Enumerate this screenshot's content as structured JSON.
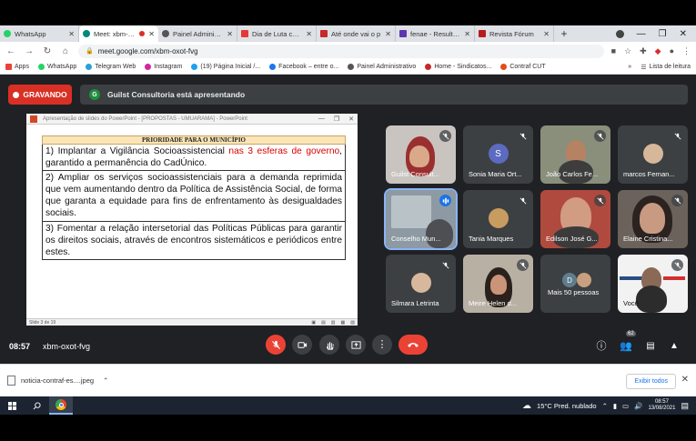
{
  "browser": {
    "tabs": [
      {
        "label": "WhatsApp",
        "color": "#25d366"
      },
      {
        "label": "Meet: xbm-oxot-fvg",
        "color": "#00897b",
        "active": true
      },
      {
        "label": "Painel Administrativo",
        "color": "#555555"
      },
      {
        "label": "Dia de Luta contra",
        "color": "#e53935"
      },
      {
        "label": "Até onde vai o p",
        "color": "#c62828"
      },
      {
        "label": "fenae - Resultados",
        "color": "#5e35b1"
      },
      {
        "label": "Revista Fórum",
        "color": "#b71c1c"
      }
    ],
    "url": "meet.google.com/xbm-oxot-fvg",
    "bookmarks": [
      {
        "label": "Apps",
        "color": "#ea4335"
      },
      {
        "label": "WhatsApp",
        "color": "#25d366"
      },
      {
        "label": "Telegram Web",
        "color": "#2aa0da"
      },
      {
        "label": "Instagram",
        "color": "#d6249f"
      },
      {
        "label": "(19) Página Inicial /...",
        "color": "#1da1f2"
      },
      {
        "label": "Facebook – entre o...",
        "color": "#1877f2"
      },
      {
        "label": "Painel Administrativo",
        "color": "#555555"
      },
      {
        "label": "Home - Sindicatos...",
        "color": "#c62828"
      },
      {
        "label": "Contraf CUT",
        "color": "#e64a19"
      }
    ],
    "reading_list": "Lista de leitura"
  },
  "meet": {
    "recording_label": "GRAVANDO",
    "presenting_avatar": "G",
    "presenting_text": "Guilst Consultoria está apresentando",
    "slide": {
      "window_title": "Apresentação de slides do PowerPoint - [PROPOSTAS - UMUARAMA] - PowerPoint",
      "heading": "PRIORIDADE PARA O MUNICÍPIO",
      "item1_pre": "1) Implantar a  Vigilância Socioassistencial ",
      "item1_red": "nas 3 esferas de governo",
      "item1_post": ", garantido a permanência do CadÚnico.",
      "item2": "2) Ampliar os serviços socioassistenciais para a demanda reprimida que vem aumentando dentro da Política de Assistência Social, de forma que garanta a equidade para fins de enfrentamento às desigualdades sociais.",
      "item3": "3) Fomentar a relação intersetorial das Políticas Públicas para garantir os direitos sociais, através de encontros sistemáticos e periódicos entre estes.",
      "status": "Slide 3 de 19"
    },
    "participants": [
      {
        "name": "Guilst Consult...",
        "initial": ""
      },
      {
        "name": "Sonia Maria Ort...",
        "initial": "S"
      },
      {
        "name": "João Carlos Fe...",
        "initial": ""
      },
      {
        "name": "marcos Fernan...",
        "initial": ""
      },
      {
        "name": "Conselho Mun...",
        "initial": ""
      },
      {
        "name": "Tania Marques",
        "initial": ""
      },
      {
        "name": "Edilson José G...",
        "initial": ""
      },
      {
        "name": "Elaine Cristina...",
        "initial": ""
      },
      {
        "name": "Silmara Letrinta",
        "initial": ""
      },
      {
        "name": "Meire Helen d...",
        "initial": ""
      },
      {
        "name": "Mais 50 pessoas",
        "initial": "D"
      },
      {
        "name": "Você",
        "initial": ""
      }
    ],
    "time": "08:57",
    "meeting_code": "xbm-oxot-fvg",
    "participant_count": "62"
  },
  "downloads": {
    "file": "noticia-contraf-es....jpeg",
    "show_all": "Exibir todos"
  },
  "taskbar": {
    "weather": "15°C  Pred. nublado",
    "time": "08:57",
    "date": "13/08/2021"
  }
}
